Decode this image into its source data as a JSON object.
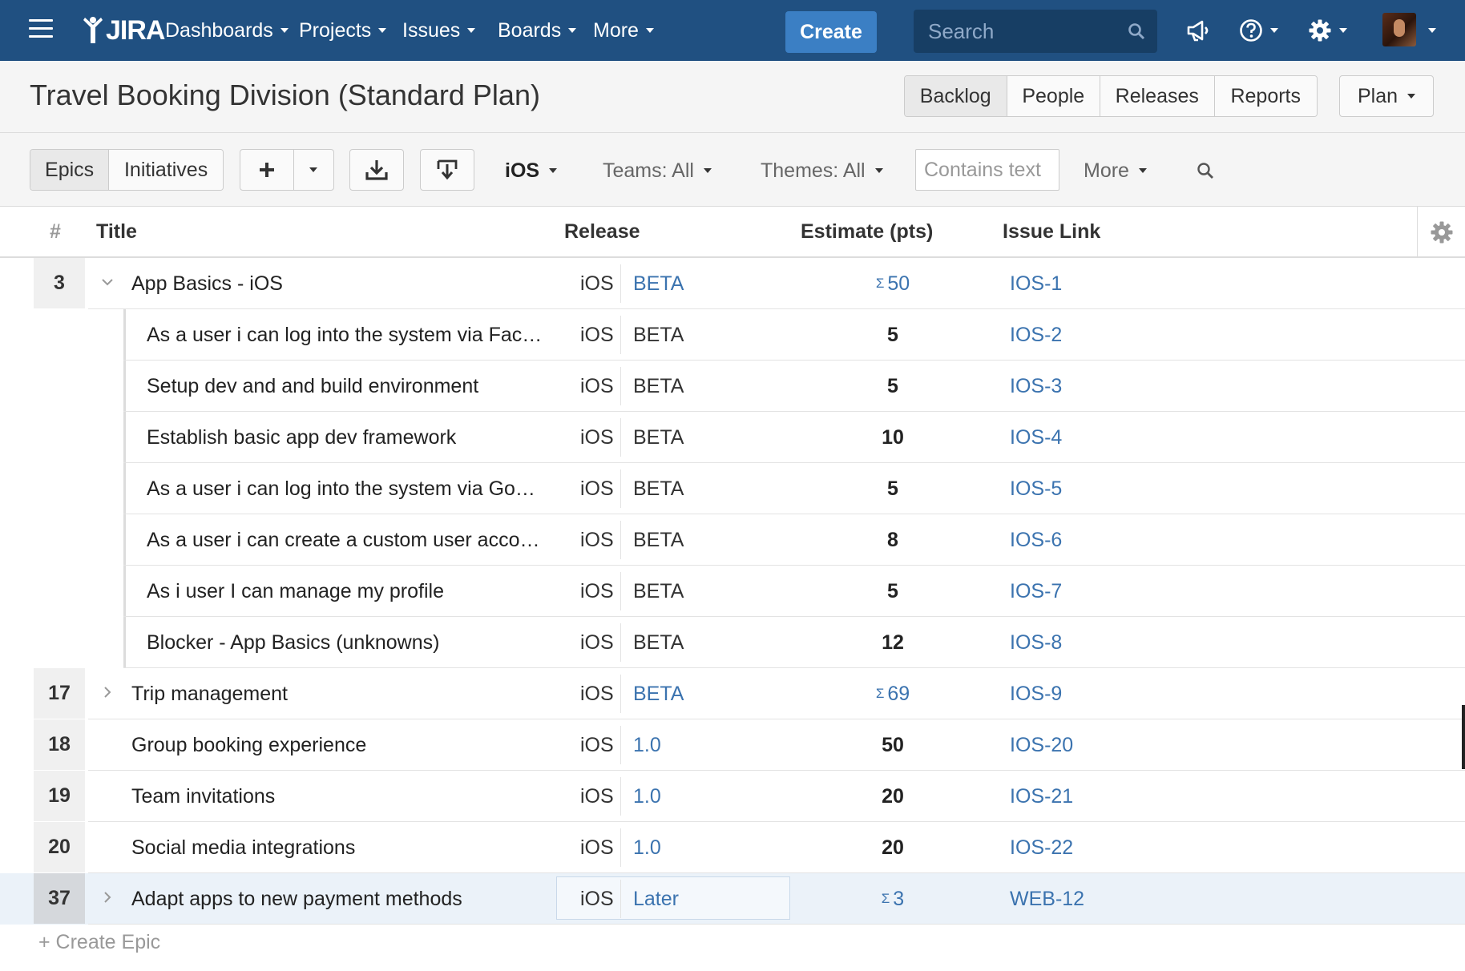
{
  "nav": {
    "logo": "JIRA",
    "items": [
      {
        "label": "Dashboards"
      },
      {
        "label": "Projects"
      },
      {
        "label": "Issues"
      },
      {
        "label": "Boards"
      },
      {
        "label": "More"
      }
    ],
    "create_label": "Create",
    "search_placeholder": "Search"
  },
  "header": {
    "title": "Travel Booking Division (Standard Plan)",
    "views": [
      "Backlog",
      "People",
      "Releases",
      "Reports"
    ],
    "active_view": "Backlog",
    "plan_label": "Plan"
  },
  "toolbar": {
    "hierarchy": [
      "Epics",
      "Initiatives"
    ],
    "active_hierarchy": "Epics",
    "project_filter": "iOS",
    "teams_filter": "Teams: All",
    "themes_filter": "Themes: All",
    "text_filter_placeholder": "Contains text",
    "more_label": "More"
  },
  "table": {
    "columns": {
      "hash": "#",
      "title": "Title",
      "release": "Release",
      "estimate": "Estimate (pts)",
      "issue": "Issue Link"
    },
    "rows": [
      {
        "num": "3",
        "title": "App Basics - iOS",
        "project": "iOS",
        "release": "BETA",
        "estimate": "50",
        "sum": true,
        "issue": "IOS-1",
        "level": "epic",
        "expanded": true
      },
      {
        "num": "",
        "title": "As a user i can log into the system via Fac…",
        "project": "iOS",
        "release": "BETA",
        "estimate": "5",
        "sum": false,
        "issue": "IOS-2",
        "level": "story"
      },
      {
        "num": "",
        "title": "Setup dev and and build environment",
        "project": "iOS",
        "release": "BETA",
        "estimate": "5",
        "sum": false,
        "issue": "IOS-3",
        "level": "story"
      },
      {
        "num": "",
        "title": "Establish basic app dev framework",
        "project": "iOS",
        "release": "BETA",
        "estimate": "10",
        "sum": false,
        "issue": "IOS-4",
        "level": "story"
      },
      {
        "num": "",
        "title": "As a user i can log into the system via Go…",
        "project": "iOS",
        "release": "BETA",
        "estimate": "5",
        "sum": false,
        "issue": "IOS-5",
        "level": "story"
      },
      {
        "num": "",
        "title": "As a user i can create a custom user acco…",
        "project": "iOS",
        "release": "BETA",
        "estimate": "8",
        "sum": false,
        "issue": "IOS-6",
        "level": "story"
      },
      {
        "num": "",
        "title": "As i user I can manage my profile",
        "project": "iOS",
        "release": "BETA",
        "estimate": "5",
        "sum": false,
        "issue": "IOS-7",
        "level": "story"
      },
      {
        "num": "",
        "title": "Blocker - App Basics (unknowns)",
        "project": "iOS",
        "release": "BETA",
        "estimate": "12",
        "sum": false,
        "issue": "IOS-8",
        "level": "story"
      },
      {
        "num": "17",
        "title": "Trip management",
        "project": "iOS",
        "release": "BETA",
        "estimate": "69",
        "sum": true,
        "issue": "IOS-9",
        "level": "epic",
        "expanded": false
      },
      {
        "num": "18",
        "title": "Group booking experience",
        "project": "iOS",
        "release": "1.0",
        "estimate": "50",
        "sum": false,
        "issue": "IOS-20",
        "level": "epic"
      },
      {
        "num": "19",
        "title": "Team invitations",
        "project": "iOS",
        "release": "1.0",
        "estimate": "20",
        "sum": false,
        "issue": "IOS-21",
        "level": "epic"
      },
      {
        "num": "20",
        "title": "Social media integrations",
        "project": "iOS",
        "release": "1.0",
        "estimate": "20",
        "sum": false,
        "issue": "IOS-22",
        "level": "epic"
      },
      {
        "num": "37",
        "title": "Adapt apps to new payment methods",
        "project": "iOS",
        "release": "Later",
        "estimate": "3",
        "sum": true,
        "issue": "WEB-12",
        "level": "epic",
        "expanded": false,
        "selected": true
      }
    ],
    "sigma": "Σ"
  },
  "footer": {
    "create_epic": "+ Create Epic"
  },
  "colors": {
    "nav_bg": "#205081",
    "create_btn": "#3b7fc4",
    "link": "#3b73af"
  }
}
